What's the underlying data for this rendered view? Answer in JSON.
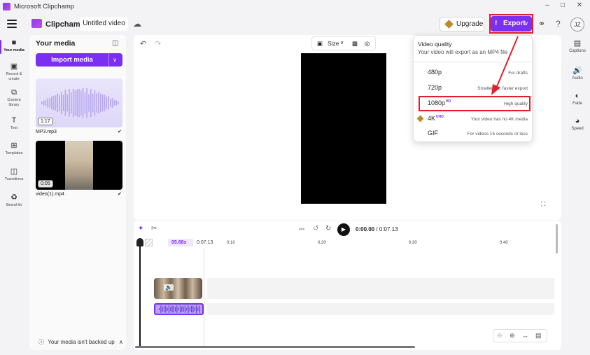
{
  "window": {
    "title": "Microsoft Clipchamp"
  },
  "header": {
    "brand": "Clipchamp",
    "project_name": "Untitled video",
    "upgrade_label": "Upgrade",
    "export_label": "Export",
    "avatar_initials": "JZ",
    "accent_color": "#7b2ff2",
    "highlight_color": "#e0202a"
  },
  "left_rail": {
    "items": [
      {
        "label": "Your media",
        "icon": "folder-icon"
      },
      {
        "label": "Record & create",
        "icon": "camera-icon"
      },
      {
        "label": "Content library",
        "icon": "library-icon"
      },
      {
        "label": "Text",
        "icon": "text-icon"
      },
      {
        "label": "Templates",
        "icon": "templates-icon"
      },
      {
        "label": "Transitions",
        "icon": "transitions-icon"
      },
      {
        "label": "Brand kit",
        "icon": "brand-kit-icon"
      }
    ]
  },
  "media_panel": {
    "title": "Your media",
    "import_label": "Import media",
    "items": [
      {
        "name": "MP3.mp3",
        "duration": "1:17"
      },
      {
        "name": "video(1).mp4",
        "duration": "0:05"
      }
    ],
    "backup_status": "Your media isn't backed up"
  },
  "preview": {
    "size_label": "Size"
  },
  "playback": {
    "current": "0:00.00",
    "total": "0:07.13"
  },
  "timeline": {
    "playhead_time": "05.68s",
    "clip_total": "0:07.13",
    "ticks": [
      "0:10",
      "0:20",
      "0:30",
      "0:40"
    ]
  },
  "right_panel": {
    "items": [
      {
        "label": "Captions",
        "icon": "captions-icon"
      },
      {
        "label": "Audio",
        "icon": "speaker-icon"
      },
      {
        "label": "Fade",
        "icon": "fade-icon"
      },
      {
        "label": "Speed",
        "icon": "speedometer-icon"
      }
    ]
  },
  "quality_menu": {
    "title": "Video quality",
    "subtitle": "Your video will export as an MP4 file",
    "options": [
      {
        "resolution": "480p",
        "badge": "",
        "description": "For drafts"
      },
      {
        "resolution": "720p",
        "badge": "",
        "description": "Smaller file, faster export"
      },
      {
        "resolution": "1080p",
        "badge": "HD",
        "description": "High quality"
      },
      {
        "resolution": "4K",
        "badge": "UHD",
        "description": "Your video has no 4K media"
      },
      {
        "resolution": "GIF",
        "badge": "",
        "description": "For videos 15 seconds or less"
      }
    ]
  }
}
